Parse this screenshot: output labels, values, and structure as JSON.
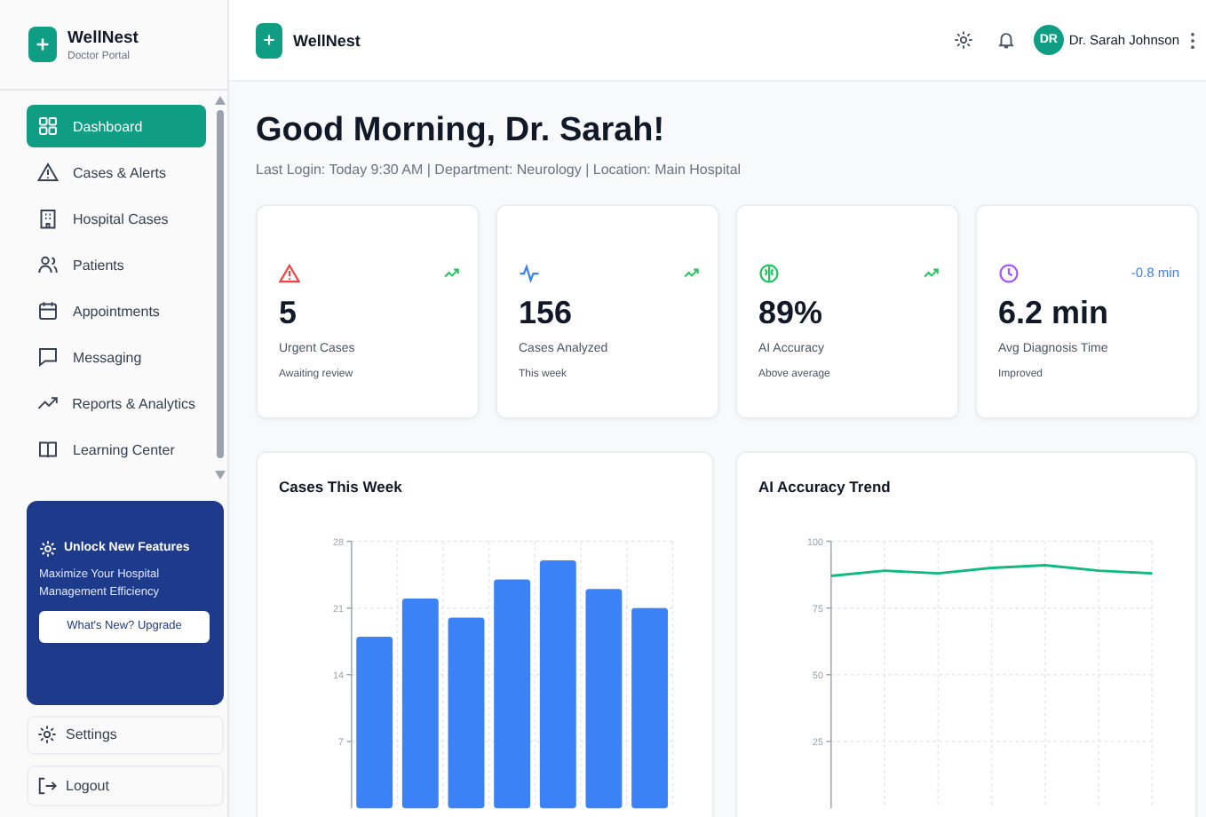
{
  "sidebar": {
    "brand": "WellNest",
    "subtitle": "Doctor Portal",
    "items": [
      {
        "label": "Dashboard",
        "selected": true
      },
      {
        "label": "Cases & Alerts",
        "selected": false
      },
      {
        "label": "Hospital Cases",
        "selected": false
      },
      {
        "label": "Patients",
        "selected": false
      },
      {
        "label": "Appointments",
        "selected": false
      },
      {
        "label": "Messaging",
        "selected": false
      },
      {
        "label": "Reports & Analytics",
        "selected": false
      },
      {
        "label": "Learning Center",
        "selected": false
      }
    ],
    "promo": {
      "title": "Unlock New Features",
      "text": "Maximize Your Hospital Management Efficiency",
      "button": "What's New? Upgrade"
    },
    "footer_items": [
      "Settings",
      "Logout"
    ]
  },
  "header": {
    "brand": "WellNest",
    "avatar": "DR",
    "user": "Dr. Sarah Johnson"
  },
  "greeting": "Good Morning, Dr. Sarah!",
  "info": "Last Login: Today 9:30 AM | Department: Neurology | Location: Main Hospital",
  "stats": [
    {
      "value": "5",
      "label": "Urgent Cases",
      "note": "Awaiting review",
      "color": "#ef4444",
      "trend_up": true
    },
    {
      "value": "156",
      "label": "Cases Analyzed",
      "note": "This week",
      "color": "#3b82f6",
      "trend_up": true
    },
    {
      "value": "89%",
      "label": "AI Accuracy",
      "note": "Above average",
      "color": "#22c55e",
      "trend_up": true
    },
    {
      "value": "6.2 min",
      "label": "Avg Diagnosis Time",
      "note": "Improved",
      "color": "#a855f7",
      "change": "-0.8 min"
    }
  ],
  "charts": [
    {
      "title": "Cases This Week",
      "chart_data": {
        "type": "bar",
        "ylim": [
          0,
          28
        ],
        "yticks": [
          7,
          14,
          21,
          28
        ],
        "grid": true,
        "series": [
          {
            "color": "#3b82f6",
            "values": [
              18,
              22,
              20,
              24,
              26,
              23,
              21
            ]
          }
        ]
      }
    },
    {
      "title": "AI Accuracy Trend",
      "chart_data": {
        "type": "line",
        "ylim": [
          0,
          100
        ],
        "yticks": [
          25,
          50,
          75,
          100
        ],
        "grid": true,
        "series": [
          {
            "color": "#10b981",
            "values": [
              87,
              89,
              88,
              90,
              91,
              89,
              88
            ]
          }
        ]
      }
    }
  ]
}
